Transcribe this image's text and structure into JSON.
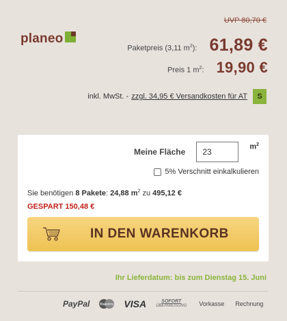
{
  "pricing": {
    "uvp": "UVP 80,70 €",
    "package_label": "Paketpreis (3,11 m",
    "package_label_sup": "2",
    "package_label_end": "):",
    "package_value": "61,89 €",
    "unit_label": "Preis 1 m",
    "unit_label_sup": "2",
    "unit_label_end": ":",
    "unit_value": "19,90 €"
  },
  "brand": {
    "name": "planeo",
    "logo_icon": "planeo-logo-icon"
  },
  "tax": {
    "text": "inkl. MwSt. -",
    "shipping_link": "zzgl. 34,95 € Versandkosten für AT",
    "country_badge": "S"
  },
  "calculator": {
    "area_label": "Meine Fläche",
    "area_value": "23",
    "area_unit": "m",
    "area_unit_sup": "2",
    "cut_label": "5% Verschnitt einkalkulieren",
    "need_prefix": "Sie benötigen ",
    "need_packages": "8 Pakete",
    "need_colon": ": ",
    "need_area": "24,88 m",
    "need_area_sup": "2",
    "need_zu": " zu ",
    "need_total": "495,12 €",
    "saved": "GESPART 150,48 €",
    "cart_button": "IN DEN WARENKORB",
    "cart_icon": "shopping-cart-icon"
  },
  "delivery": {
    "text": "Ihr Lieferdatum: bis zum Dienstag 15. Juni"
  },
  "payments": {
    "paypal": "PayPal",
    "maestro": "Maestro",
    "visa": "VISA",
    "sofort_top": "SOFORT",
    "sofort_bottom": "ÜBERWEISUNG",
    "vorkasse": "Vorkasse",
    "rechnung": "Rechnung"
  },
  "colors": {
    "brand": "#7a3a2e",
    "accent_green": "#8ab43c",
    "saved_red": "#c0201a",
    "button_yellow": "#f2c75c"
  }
}
